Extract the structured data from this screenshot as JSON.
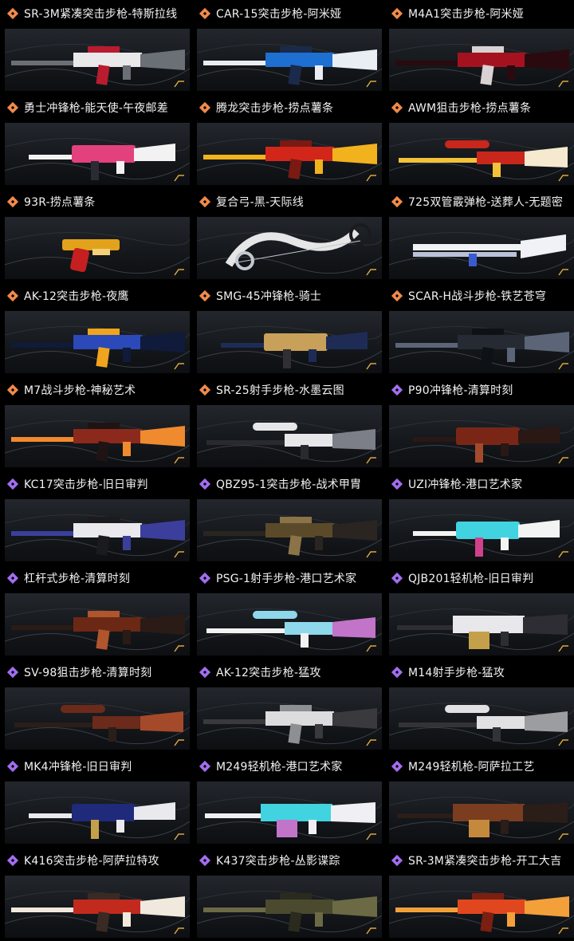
{
  "rank_colors": {
    "orange": "#f08a4b",
    "purple": "#a26ef0"
  },
  "items": [
    {
      "name": "SR-3M紧凑突击步枪-特斯拉线",
      "rank": "orange",
      "icon": "rifle-icon",
      "colors": [
        "#e9e9ea",
        "#6b6f76",
        "#b81c2e"
      ]
    },
    {
      "name": "CAR-15突击步枪-阿米娅",
      "rank": "orange",
      "icon": "rifle-icon",
      "colors": [
        "#1d6fd1",
        "#e9eef5",
        "#1b2a4a"
      ]
    },
    {
      "name": "M4A1突击步枪-阿米娅",
      "rank": "orange",
      "icon": "rifle-icon",
      "colors": [
        "#a5121f",
        "#2a0a0e",
        "#d8d2d2"
      ]
    },
    {
      "name": "勇士冲锋枪-能天使-午夜邮差",
      "rank": "orange",
      "icon": "smg-icon",
      "colors": [
        "#e3407e",
        "#f2f2f2",
        "#2b2b33"
      ]
    },
    {
      "name": "腾龙突击步枪-捞点薯条",
      "rank": "orange",
      "icon": "rifle-icon",
      "colors": [
        "#d3261b",
        "#f2b21e",
        "#7a1a12"
      ]
    },
    {
      "name": "AWM狙击步枪-捞点薯条",
      "rank": "orange",
      "icon": "sniper-icon",
      "colors": [
        "#c9261c",
        "#f3c23a",
        "#f5e9d0"
      ]
    },
    {
      "name": "93R-捞点薯条",
      "rank": "orange",
      "icon": "pistol-icon",
      "colors": [
        "#e3a21b",
        "#c51f1f",
        "#f3d07a"
      ]
    },
    {
      "name": "复合弓-黑-天际线",
      "rank": "orange",
      "icon": "bow-icon",
      "colors": [
        "#e6e6e6",
        "#1b1b1f",
        "#c4c8cf"
      ]
    },
    {
      "name": "725双管霰弹枪-送葬人-无题密",
      "rank": "orange",
      "icon": "shotgun-icon",
      "colors": [
        "#f0f2f6",
        "#3a5bd0",
        "#b9c2d6"
      ]
    },
    {
      "name": "AK-12突击步枪-夜鹰",
      "rank": "orange",
      "icon": "rifle-icon",
      "colors": [
        "#2b49b8",
        "#101a3a",
        "#f0a41e"
      ]
    },
    {
      "name": "SMG-45冲锋枪-骑士",
      "rank": "orange",
      "icon": "smg-icon",
      "colors": [
        "#c8a05a",
        "#1e2c55",
        "#2f2f35"
      ]
    },
    {
      "name": "SCAR-H战斗步枪-铁艺苍穹",
      "rank": "orange",
      "icon": "rifle-icon",
      "colors": [
        "#262a32",
        "#5b6577",
        "#0e1116"
      ]
    },
    {
      "name": "M7战斗步枪-神秘艺术",
      "rank": "orange",
      "icon": "rifle-icon",
      "colors": [
        "#8b2a1c",
        "#f08a2e",
        "#1e1414"
      ]
    },
    {
      "name": "SR-25射手步枪-水墨云图",
      "rank": "orange",
      "icon": "sniper-icon",
      "colors": [
        "#e7e7ea",
        "#2a2a2e",
        "#7c7f88"
      ]
    },
    {
      "name": "P90冲锋枪-清算时刻",
      "rank": "purple",
      "icon": "smg-icon",
      "colors": [
        "#7a2616",
        "#2a1814",
        "#a34a2c"
      ]
    },
    {
      "name": "KC17突击步枪-旧日审判",
      "rank": "purple",
      "icon": "rifle-icon",
      "colors": [
        "#e9e9ee",
        "#3b3f9b",
        "#1a1a1f"
      ]
    },
    {
      "name": "QBZ95-1突击步枪-战术甲胄",
      "rank": "purple",
      "icon": "rifle-icon",
      "colors": [
        "#5b4a2a",
        "#2a2520",
        "#8a7346"
      ]
    },
    {
      "name": "UZI冲锋枪-港口艺术家",
      "rank": "purple",
      "icon": "smg-icon",
      "colors": [
        "#41d3e0",
        "#f3f3f3",
        "#d0418b"
      ]
    },
    {
      "name": "杠杆式步枪-清算时刻",
      "rank": "purple",
      "icon": "rifle-icon",
      "colors": [
        "#6b2814",
        "#2a1b16",
        "#b0552c"
      ]
    },
    {
      "name": "PSG-1射手步枪-港口艺术家",
      "rank": "purple",
      "icon": "sniper-icon",
      "colors": [
        "#8fd7ea",
        "#f2f2f2",
        "#c274c9"
      ]
    },
    {
      "name": "QJB201轻机枪-旧日审判",
      "rank": "purple",
      "icon": "mg-icon",
      "colors": [
        "#e8e8ec",
        "#2d2d33",
        "#c5a04a"
      ]
    },
    {
      "name": "SV-98狙击步枪-清算时刻",
      "rank": "purple",
      "icon": "sniper-icon",
      "colors": [
        "#6b2a1a",
        "#2b1e19",
        "#a44a2a"
      ]
    },
    {
      "name": "AK-12突击步枪-猛攻",
      "rank": "purple",
      "icon": "rifle-icon",
      "colors": [
        "#dcdcde",
        "#3a3a3e",
        "#8e8f93"
      ]
    },
    {
      "name": "M14射手步枪-猛攻",
      "rank": "purple",
      "icon": "sniper-icon",
      "colors": [
        "#e1e1e3",
        "#333337",
        "#9c9da1"
      ]
    },
    {
      "name": "MK4冲锋枪-旧日审判",
      "rank": "purple",
      "icon": "smg-icon",
      "colors": [
        "#1f2a7a",
        "#e9e9ee",
        "#c5a04a"
      ]
    },
    {
      "name": "M249轻机枪-港口艺术家",
      "rank": "purple",
      "icon": "mg-icon",
      "colors": [
        "#41d3e0",
        "#f0f0f4",
        "#c274c9"
      ]
    },
    {
      "name": "M249轻机枪-阿萨拉工艺",
      "rank": "purple",
      "icon": "mg-icon",
      "colors": [
        "#7a3d1f",
        "#2b1d18",
        "#c5893d"
      ]
    },
    {
      "name": "K416突击步枪-阿萨拉特攻",
      "rank": "purple",
      "icon": "rifle-icon",
      "colors": [
        "#c22a1d",
        "#f1e9dd",
        "#3a2a24"
      ]
    },
    {
      "name": "K437突击步枪-丛影谍踪",
      "rank": "purple",
      "icon": "rifle-icon",
      "colors": [
        "#4b4a2e",
        "#6b6a44",
        "#2a2a1f"
      ]
    },
    {
      "name": "SR-3M紧凑突击步枪-开工大吉",
      "rank": "purple",
      "icon": "rifle-icon",
      "colors": [
        "#e0471f",
        "#f3a03b",
        "#7a1f12"
      ]
    }
  ]
}
